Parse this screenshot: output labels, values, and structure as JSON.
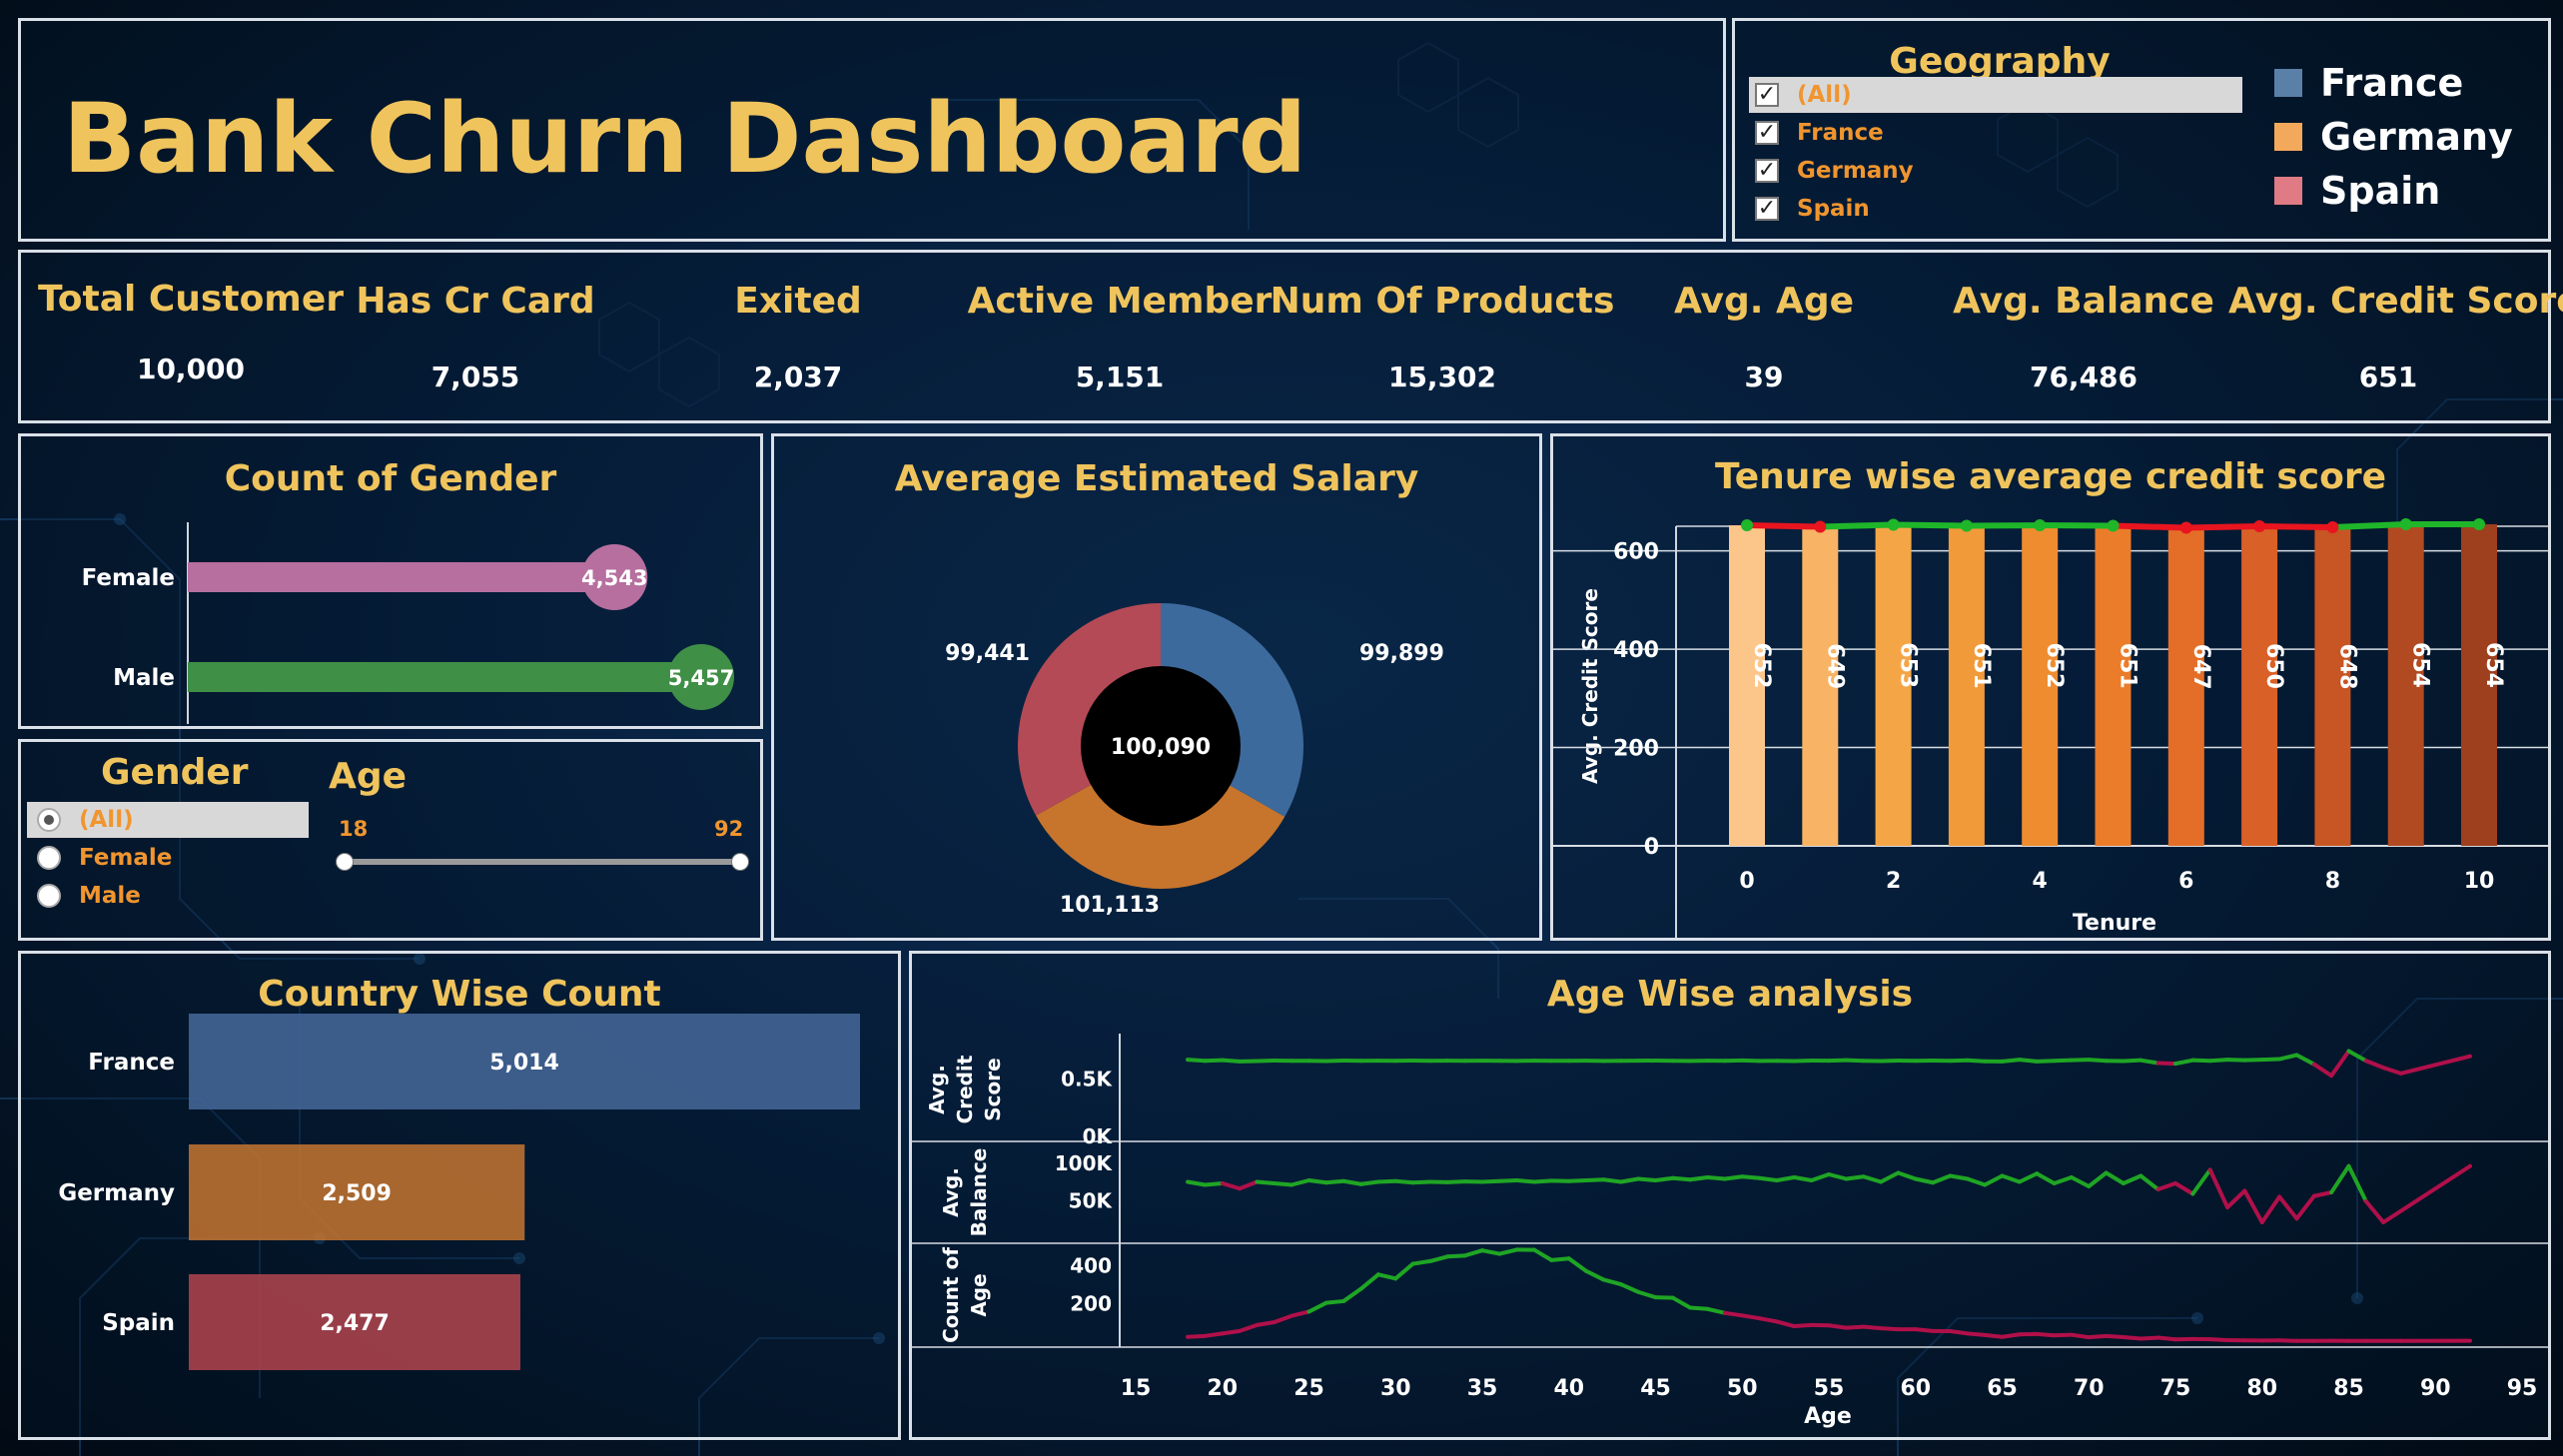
{
  "header": {
    "title": "Bank Churn Dashboard"
  },
  "geography_filter": {
    "title": "Geography",
    "options": [
      {
        "label": "(All)",
        "checked": true,
        "selected": true
      },
      {
        "label": "France",
        "checked": true
      },
      {
        "label": "Germany",
        "checked": true
      },
      {
        "label": "Spain",
        "checked": true
      }
    ],
    "check_mark": "✓"
  },
  "legend": {
    "items": [
      {
        "label": "France",
        "color": "#5b80a8"
      },
      {
        "label": "Germany",
        "color": "#f3a95b"
      },
      {
        "label": "Spain",
        "color": "#e07b85"
      }
    ]
  },
  "kpis": [
    {
      "label": "Total Customer",
      "value": "10,000"
    },
    {
      "label": "Has Cr Card",
      "value": "7,055"
    },
    {
      "label": "Exited",
      "value": "2,037"
    },
    {
      "label": "Active Member",
      "value": "5,151"
    },
    {
      "label": "Num Of Products",
      "value": "15,302"
    },
    {
      "label": "Avg. Age",
      "value": "39"
    },
    {
      "label": "Avg. Balance",
      "value": "76,486"
    },
    {
      "label": "Avg. Credit Score",
      "value": "651"
    }
  ],
  "gender_filter": {
    "title": "Gender",
    "options": [
      {
        "label": "(All)",
        "selected": true
      },
      {
        "label": "Female",
        "selected": false
      },
      {
        "label": "Male",
        "selected": false
      }
    ]
  },
  "age_filter": {
    "title": "Age",
    "min": "18",
    "max": "92"
  },
  "colors": {
    "accent": "#f0c45c",
    "border": "#d9e0e8"
  },
  "chart_data": [
    {
      "id": "gender",
      "type": "bar",
      "title": "Count of Gender",
      "categories": [
        "Female",
        "Male"
      ],
      "values": [
        4543,
        5457
      ],
      "labels": [
        "4,543",
        "5,457"
      ],
      "colors": [
        "#b66f9f",
        "#3f8f46"
      ],
      "xlim": [
        0,
        5457
      ]
    },
    {
      "id": "salary",
      "type": "pie",
      "title": "Average Estimated Salary",
      "categories": [
        "France",
        "Germany",
        "Spain"
      ],
      "values": [
        99899,
        101113,
        99441
      ],
      "labels": [
        "99,899",
        "101,113",
        "99,441"
      ],
      "center_label": "100,090",
      "colors": [
        "#3d6a9c",
        "#c7752c",
        "#b44a55"
      ]
    },
    {
      "id": "tenure",
      "type": "bar",
      "title": "Tenure wise average credit score",
      "xlabel": "Tenure",
      "ylabel": "Avg. Credit Score",
      "categories": [
        0,
        1,
        2,
        3,
        4,
        5,
        6,
        7,
        8,
        9,
        10
      ],
      "values": [
        652,
        649,
        653,
        651,
        652,
        651,
        647,
        650,
        648,
        654,
        654
      ],
      "ylim": [
        0,
        650
      ],
      "yticks": [
        0,
        200,
        400,
        600
      ],
      "xticks": [
        0,
        2,
        4,
        6,
        8,
        10
      ],
      "bar_colors": [
        "#fcc68a",
        "#f8b364",
        "#f4a647",
        "#f19a3a",
        "#ee8c2f",
        "#eb7c2a",
        "#e46e27",
        "#d96027",
        "#c85524",
        "#b24a21",
        "#9e3f1e"
      ],
      "line_colors": {
        "above": "#1fb62a",
        "below": "#e8151f"
      }
    },
    {
      "id": "country",
      "type": "bar",
      "title": "Country Wise Count",
      "categories": [
        "France",
        "Germany",
        "Spain"
      ],
      "values": [
        5014,
        2509,
        2477
      ],
      "labels": [
        "5,014",
        "2,509",
        "2,477"
      ],
      "colors": [
        "#46699a",
        "#c57630",
        "#b3454f"
      ],
      "xlim": [
        0,
        5014
      ]
    },
    {
      "id": "age",
      "type": "line",
      "title": "Age Wise analysis",
      "xlabel": "Age",
      "xlim": [
        15,
        95
      ],
      "xticks": [
        15,
        20,
        25,
        30,
        35,
        40,
        45,
        50,
        55,
        60,
        65,
        70,
        75,
        80,
        85,
        90,
        95
      ],
      "line_colors": {
        "high": "#1fa524",
        "low": "#b0104a"
      },
      "series": [
        {
          "name": "Avg. Credit Score",
          "axis_title": [
            "Avg.",
            "Credit",
            "Score"
          ],
          "ylim": [
            0,
            800
          ],
          "ytick_values": [
            0,
            500
          ],
          "ytick_labels": [
            "0K",
            "0.5K"
          ],
          "points": [
            [
              18,
              660
            ],
            [
              19,
              650
            ],
            [
              20,
              655
            ],
            [
              21,
              645
            ],
            [
              22,
              648
            ],
            [
              23,
              652
            ],
            [
              24,
              650
            ],
            [
              25,
              650
            ],
            [
              26,
              648
            ],
            [
              27,
              652
            ],
            [
              28,
              650
            ],
            [
              29,
              651
            ],
            [
              30,
              650
            ],
            [
              31,
              652
            ],
            [
              32,
              650
            ],
            [
              33,
              651
            ],
            [
              34,
              650
            ],
            [
              35,
              651
            ],
            [
              36,
              650
            ],
            [
              37,
              649
            ],
            [
              38,
              651
            ],
            [
              39,
              650
            ],
            [
              40,
              650
            ],
            [
              41,
              651
            ],
            [
              42,
              649
            ],
            [
              43,
              650
            ],
            [
              44,
              651
            ],
            [
              45,
              652
            ],
            [
              46,
              650
            ],
            [
              47,
              649
            ],
            [
              48,
              651
            ],
            [
              49,
              650
            ],
            [
              50,
              653
            ],
            [
              51,
              649
            ],
            [
              52,
              650
            ],
            [
              53,
              648
            ],
            [
              54,
              652
            ],
            [
              55,
              651
            ],
            [
              56,
              655
            ],
            [
              57,
              650
            ],
            [
              58,
              648
            ],
            [
              59,
              652
            ],
            [
              60,
              650
            ],
            [
              61,
              652
            ],
            [
              62,
              650
            ],
            [
              63,
              654
            ],
            [
              64,
              646
            ],
            [
              65,
              645
            ],
            [
              66,
              660
            ],
            [
              67,
              645
            ],
            [
              68,
              650
            ],
            [
              69,
              655
            ],
            [
              70,
              660
            ],
            [
              71,
              650
            ],
            [
              72,
              648
            ],
            [
              73,
              655
            ],
            [
              74,
              630
            ],
            [
              75,
              625
            ],
            [
              76,
              655
            ],
            [
              77,
              650
            ],
            [
              78,
              660
            ],
            [
              79,
              655
            ],
            [
              80,
              660
            ],
            [
              81,
              665
            ],
            [
              82,
              700
            ],
            [
              83,
              620
            ],
            [
              84,
              520
            ],
            [
              85,
              735
            ],
            [
              86,
              650
            ],
            [
              87,
              590
            ],
            [
              88,
              540
            ],
            [
              92,
              690
            ]
          ]
        },
        {
          "name": "Avg. Balance",
          "axis_title": [
            "Avg.",
            "Balance"
          ],
          "ylim": [
            0,
            120000
          ],
          "ytick_values": [
            50000,
            100000
          ],
          "ytick_labels": [
            "50K",
            "100K"
          ],
          "points": [
            [
              18,
              74000
            ],
            [
              19,
              70000
            ],
            [
              20,
              72000
            ],
            [
              21,
              65000
            ],
            [
              22,
              74000
            ],
            [
              23,
              72000
            ],
            [
              24,
              70000
            ],
            [
              25,
              76000
            ],
            [
              26,
              73000
            ],
            [
              27,
              75000
            ],
            [
              28,
              71000
            ],
            [
              29,
              74000
            ],
            [
              30,
              75000
            ],
            [
              31,
              73000
            ],
            [
              32,
              74000
            ],
            [
              33,
              73500
            ],
            [
              34,
              74500
            ],
            [
              35,
              74000
            ],
            [
              36,
              75000
            ],
            [
              37,
              76000
            ],
            [
              38,
              74000
            ],
            [
              39,
              75500
            ],
            [
              40,
              75000
            ],
            [
              41,
              76000
            ],
            [
              42,
              77000
            ],
            [
              43,
              74000
            ],
            [
              44,
              78000
            ],
            [
              45,
              76000
            ],
            [
              46,
              79000
            ],
            [
              47,
              77000
            ],
            [
              48,
              80000
            ],
            [
              49,
              78000
            ],
            [
              50,
              81000
            ],
            [
              51,
              79000
            ],
            [
              52,
              76000
            ],
            [
              53,
              80000
            ],
            [
              54,
              76000
            ],
            [
              55,
              84000
            ],
            [
              56,
              78000
            ],
            [
              57,
              81000
            ],
            [
              58,
              74000
            ],
            [
              59,
              86000
            ],
            [
              60,
              78000
            ],
            [
              61,
              73000
            ],
            [
              62,
              82000
            ],
            [
              63,
              78000
            ],
            [
              64,
              70000
            ],
            [
              65,
              82000
            ],
            [
              66,
              74000
            ],
            [
              67,
              85000
            ],
            [
              68,
              72000
            ],
            [
              69,
              80000
            ],
            [
              70,
              68000
            ],
            [
              71,
              86000
            ],
            [
              72,
              72000
            ],
            [
              73,
              82000
            ],
            [
              74,
              64000
            ],
            [
              75,
              72000
            ],
            [
              76,
              58000
            ],
            [
              77,
              90000
            ],
            [
              78,
              40000
            ],
            [
              79,
              62000
            ],
            [
              80,
              20000
            ],
            [
              81,
              54000
            ],
            [
              82,
              25000
            ],
            [
              83,
              55000
            ],
            [
              84,
              60000
            ],
            [
              85,
              95000
            ],
            [
              86,
              48000
            ],
            [
              87,
              20000
            ],
            [
              92,
              95000
            ]
          ]
        },
        {
          "name": "Count of Age",
          "axis_title": [
            "Count of",
            "Age"
          ],
          "ylim": [
            0,
            480
          ],
          "ytick_values": [
            200,
            400
          ],
          "ytick_labels": [
            "200",
            "400"
          ],
          "points": [
            [
              18,
              22
            ],
            [
              19,
              27
            ],
            [
              20,
              40
            ],
            [
              21,
              53
            ],
            [
              22,
              84
            ],
            [
              23,
              99
            ],
            [
              24,
              132
            ],
            [
              25,
              154
            ],
            [
              26,
              200
            ],
            [
              27,
              209
            ],
            [
              28,
              273
            ],
            [
              29,
              348
            ],
            [
              30,
              327
            ],
            [
              31,
              404
            ],
            [
              32,
              418
            ],
            [
              33,
              442
            ],
            [
              34,
              447
            ],
            [
              35,
              474
            ],
            [
              36,
              456
            ],
            [
              37,
              478
            ],
            [
              38,
              477
            ],
            [
              39,
              423
            ],
            [
              40,
              432
            ],
            [
              41,
              366
            ],
            [
              42,
              321
            ],
            [
              43,
              297
            ],
            [
              44,
              257
            ],
            [
              45,
              229
            ],
            [
              46,
              226
            ],
            [
              47,
              175
            ],
            [
              48,
              168
            ],
            [
              49,
              147
            ],
            [
              50,
              134
            ],
            [
              51,
              119
            ],
            [
              52,
              102
            ],
            [
              53,
              78
            ],
            [
              54,
              84
            ],
            [
              55,
              82
            ],
            [
              56,
              70
            ],
            [
              57,
              75
            ],
            [
              58,
              67
            ],
            [
              59,
              62
            ],
            [
              60,
              62
            ],
            [
              61,
              53
            ],
            [
              62,
              52
            ],
            [
              63,
              40
            ],
            [
              64,
              32
            ],
            [
              65,
              22
            ],
            [
              66,
              35
            ],
            [
              67,
              37
            ],
            [
              68,
              30
            ],
            [
              69,
              33
            ],
            [
              70,
              20
            ],
            [
              71,
              27
            ],
            [
              72,
              21
            ],
            [
              73,
              13
            ],
            [
              74,
              18
            ],
            [
              75,
              9
            ],
            [
              76,
              11
            ],
            [
              77,
              10
            ],
            [
              78,
              5
            ],
            [
              79,
              4
            ],
            [
              80,
              3
            ],
            [
              81,
              4
            ],
            [
              82,
              1
            ],
            [
              83,
              1
            ],
            [
              84,
              2
            ],
            [
              85,
              1
            ],
            [
              86,
              1
            ],
            [
              88,
              1
            ],
            [
              92,
              2
            ]
          ]
        }
      ]
    }
  ]
}
